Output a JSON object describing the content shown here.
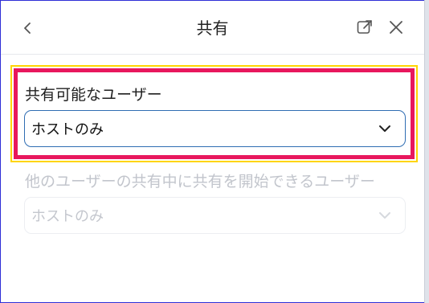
{
  "header": {
    "title": "共有",
    "icons": {
      "back": "chevron-left-icon",
      "popout": "external-link-icon",
      "close": "close-icon"
    }
  },
  "sharing": {
    "who_can_share": {
      "label": "共有可能なユーザー",
      "value": "ホストのみ"
    },
    "who_can_start_while_sharing": {
      "label": "他のユーザーの共有中に共有を開始できるユーザー",
      "value": "ホストのみ",
      "disabled": true
    }
  },
  "colors": {
    "accent_border": "#2f6db3",
    "highlight_outer": "#ffd400",
    "highlight_inner": "#e8175d",
    "frame": "#2f2fd6"
  }
}
